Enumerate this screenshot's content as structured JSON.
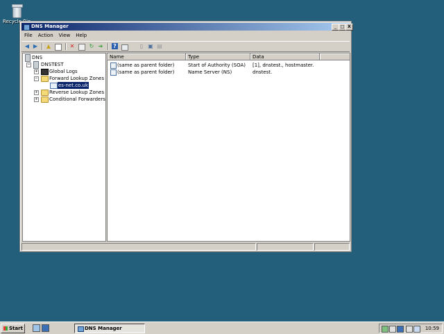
{
  "desktop": {
    "recycle_bin_label": "Recycle Bin"
  },
  "window": {
    "title": "DNS Manager",
    "minimize_glyph": "_",
    "maximize_glyph": "□",
    "close_glyph": "X"
  },
  "menu": {
    "file": "File",
    "action": "Action",
    "view": "View",
    "help": "Help"
  },
  "toolbar": {
    "back": "back-arrow-icon",
    "forward": "forward-arrow-icon",
    "up": "up-folder-icon",
    "show_hide": "show-hide-tree-icon",
    "delete": "delete-icon",
    "properties": "properties-icon",
    "refresh": "refresh-icon",
    "export": "export-list-icon",
    "help": "help-icon",
    "console": "console-icon"
  },
  "tree": {
    "root": "DNS",
    "server": "DNSTEST",
    "global_logs": "Global Logs",
    "forward_zones": "Forward Lookup Zones",
    "zone": "es-net.co.uk",
    "reverse_zones": "Reverse Lookup Zones",
    "conditional": "Conditional Forwarders"
  },
  "list": {
    "columns": {
      "name": "Name",
      "type": "Type",
      "data": "Data"
    },
    "rows": [
      {
        "name": "(same as parent folder)",
        "type": "Start of Authority (SOA)",
        "data": "[1], dnstest., hostmaster."
      },
      {
        "name": "(same as parent folder)",
        "type": "Name Server (NS)",
        "data": "dnstest."
      }
    ]
  },
  "taskbar": {
    "start": "Start",
    "task_label": "DNS Manager",
    "clock": "10:59"
  },
  "colors": {
    "desktop": "#235f7a",
    "title_start": "#0a246a",
    "title_end": "#a6caf0",
    "selection": "#0a246a"
  }
}
